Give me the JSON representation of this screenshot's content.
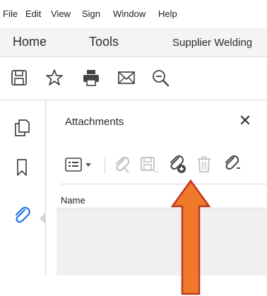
{
  "menubar": {
    "items": [
      "File",
      "Edit",
      "View",
      "Sign",
      "Window",
      "Help"
    ]
  },
  "tabs": {
    "home": "Home",
    "tools": "Tools",
    "document": "Supplier Welding"
  },
  "toolbar": {
    "icons": [
      "save-icon",
      "bookmark-star-icon",
      "print-icon",
      "email-icon",
      "zoom-out-icon"
    ]
  },
  "left_rail": {
    "icons": [
      "page-thumbnails-icon",
      "bookmarks-icon",
      "attachments-icon"
    ],
    "active": "attachments-icon"
  },
  "attachments_panel": {
    "title": "Attachments",
    "close_glyph": "✕",
    "tools": [
      "options-menu-icon",
      "open-attachment-icon",
      "save-attachment-icon",
      "add-file-icon",
      "delete-icon",
      "more-attachment-icon"
    ],
    "column_header": "Name"
  },
  "annotation": {
    "arrow_color": "#ef7a2b",
    "arrow_stroke": "#c0361e",
    "points_to": "add-file-icon"
  },
  "colors": {
    "accent_blue": "#1a73e8"
  }
}
